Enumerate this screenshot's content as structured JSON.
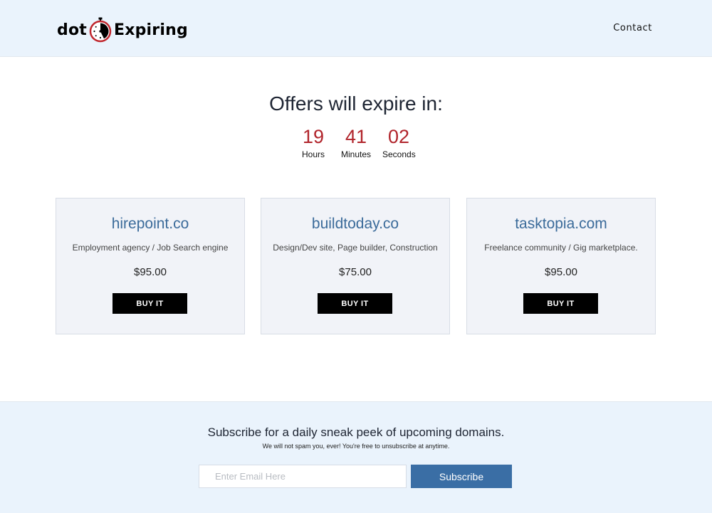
{
  "header": {
    "logo_left": "dot",
    "logo_right": "Expiring",
    "logo_icon": "stopwatch-icon",
    "nav_contact": "Contact"
  },
  "countdown": {
    "title": "Offers will expire in:",
    "hours": "19",
    "hours_label": "Hours",
    "minutes": "41",
    "minutes_label": "Minutes",
    "seconds": "02",
    "seconds_label": "Seconds"
  },
  "cards": [
    {
      "domain": "hirepoint.co",
      "desc": "Employment agency / Job Search engine",
      "price": "$95.00",
      "button": "BUY IT"
    },
    {
      "domain": "buildtoday.co",
      "desc": "Design/Dev site, Page builder, Construction",
      "price": "$75.00",
      "button": "BUY IT"
    },
    {
      "domain": "tasktopia.com",
      "desc": "Freelance community / Gig marketplace.",
      "price": "$95.00",
      "button": "BUY IT"
    }
  ],
  "subscribe": {
    "title": "Subscribe for a daily sneak peek of upcoming domains.",
    "note": "We will not spam you, ever! You're free to unsubscribe at anytime.",
    "email_placeholder": "Enter Email Here",
    "email_value": "",
    "button": "Subscribe"
  },
  "colors": {
    "header_bg": "#eaf3fc",
    "timer_red": "#b1252c",
    "domain_blue": "#3b6b9a",
    "subscribe_blue": "#3a6ea5"
  }
}
